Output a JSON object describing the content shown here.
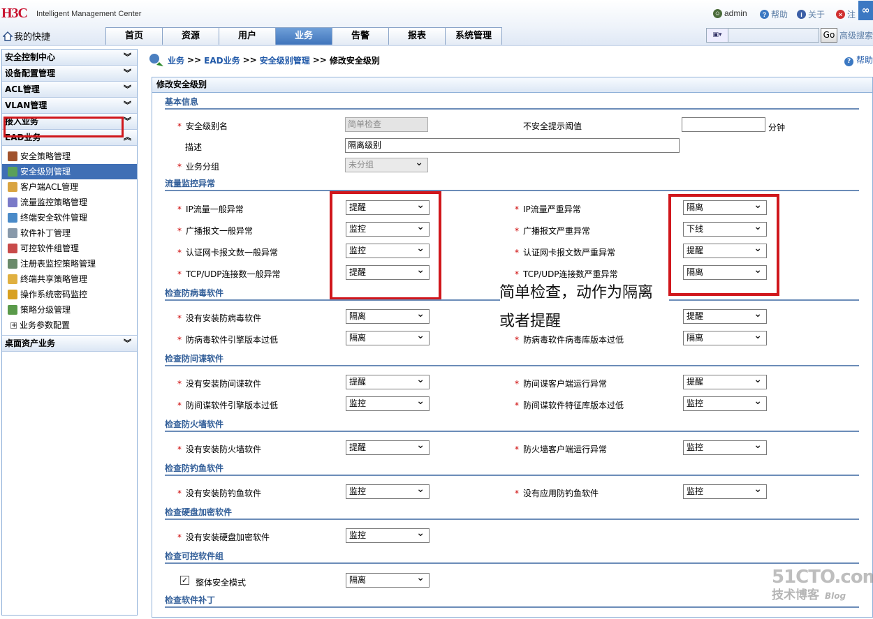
{
  "header": {
    "logo": "H3C",
    "product": "Intelligent Management Center",
    "user": "admin",
    "help": "帮助",
    "about": "关于",
    "logout": "注",
    "quick": "我的快捷",
    "tabs": [
      "首页",
      "资源",
      "用户",
      "业务",
      "告警",
      "报表",
      "系统管理"
    ],
    "active_tab": "业务",
    "search_go": "Go",
    "search_advanced": "高级搜索"
  },
  "sidebar": {
    "sections": [
      "安全控制中心",
      "设备配置管理",
      "ACL管理",
      "VLAN管理",
      "接入业务",
      "EAD业务"
    ],
    "ead_items": [
      "安全策略管理",
      "安全级别管理",
      "客户端ACL管理",
      "流量监控策略管理",
      "终端安全软件管理",
      "软件补丁管理",
      "可控软件组管理",
      "注册表监控策略管理",
      "终端共享策略管理",
      "操作系统密码监控",
      "策略分级管理",
      "业务参数配置"
    ],
    "selected_item": "安全级别管理",
    "last_section": "桌面资产业务"
  },
  "breadcrumb": {
    "items": [
      "业务",
      "EAD业务",
      "安全级别管理",
      "修改安全级别"
    ],
    "sep": ">>",
    "help": "帮助"
  },
  "panel": {
    "title": "修改安全级别",
    "basic": {
      "title": "基本信息",
      "name_label": "安全级别名",
      "name_value": "简单检查",
      "threshold_label": "不安全提示阈值",
      "threshold_value": "",
      "threshold_unit": "分钟",
      "desc_label": "描述",
      "desc_value": "隔离级别",
      "group_label": "业务分组",
      "group_value": "未分组"
    },
    "traffic": {
      "title": "流量监控异常",
      "left": [
        {
          "label": "IP流量一般异常",
          "value": "提醒"
        },
        {
          "label": "广播报文一般异常",
          "value": "监控"
        },
        {
          "label": "认证网卡报文数一般异常",
          "value": "监控"
        },
        {
          "label": "TCP/UDP连接数一般异常",
          "value": "提醒"
        }
      ],
      "right": [
        {
          "label": "IP流量严重异常",
          "value": "隔离"
        },
        {
          "label": "广播报文严重异常",
          "value": "下线"
        },
        {
          "label": "认证网卡报文数严重异常",
          "value": "提醒"
        },
        {
          "label": "TCP/UDP连接数严重异常",
          "value": "隔离"
        }
      ]
    },
    "annotation": [
      "简单检查，动作为隔离",
      "或者提醒"
    ],
    "antivirus": {
      "title": "检查防病毒软件",
      "left": [
        {
          "label": "没有安装防病毒软件",
          "value": "隔离"
        },
        {
          "label": "防病毒软件引擎版本过低",
          "value": "隔离"
        }
      ],
      "right": [
        {
          "label": "",
          "value": "提醒"
        },
        {
          "label": "防病毒软件病毒库版本过低",
          "value": "隔离"
        }
      ]
    },
    "antispy": {
      "title": "检查防间谍软件",
      "left": [
        {
          "label": "没有安装防间谍软件",
          "value": "提醒"
        },
        {
          "label": "防间谍软件引擎版本过低",
          "value": "监控"
        }
      ],
      "right": [
        {
          "label": "防间谍客户端运行异常",
          "value": "提醒"
        },
        {
          "label": "防间谍软件特征库版本过低",
          "value": "监控"
        }
      ]
    },
    "firewall": {
      "title": "检查防火墙软件",
      "left": {
        "label": "没有安装防火墙软件",
        "value": "提醒"
      },
      "right": {
        "label": "防火墙客户端运行异常",
        "value": "监控"
      }
    },
    "antiphishing": {
      "title": "检查防钓鱼软件",
      "left": {
        "label": "没有安装防钓鱼软件",
        "value": "监控"
      },
      "right": {
        "label": "没有应用防钓鱼软件",
        "value": "监控"
      }
    },
    "diskenc": {
      "title": "检查硬盘加密软件",
      "left": {
        "label": "没有安装硬盘加密软件",
        "value": "监控"
      }
    },
    "controlled": {
      "title": "检查可控软件组",
      "left": {
        "label": "整体安全模式",
        "value": "隔离",
        "checked": true
      }
    },
    "patch": {
      "title": "检查软件补丁"
    }
  },
  "watermark": {
    "top": "51CTO.com",
    "bottom": "技术博客",
    "blog": "Blog"
  },
  "colors": {
    "accent": "#3f6fb5",
    "highlight_red": "#d0171c",
    "section_title": "#335f99"
  }
}
